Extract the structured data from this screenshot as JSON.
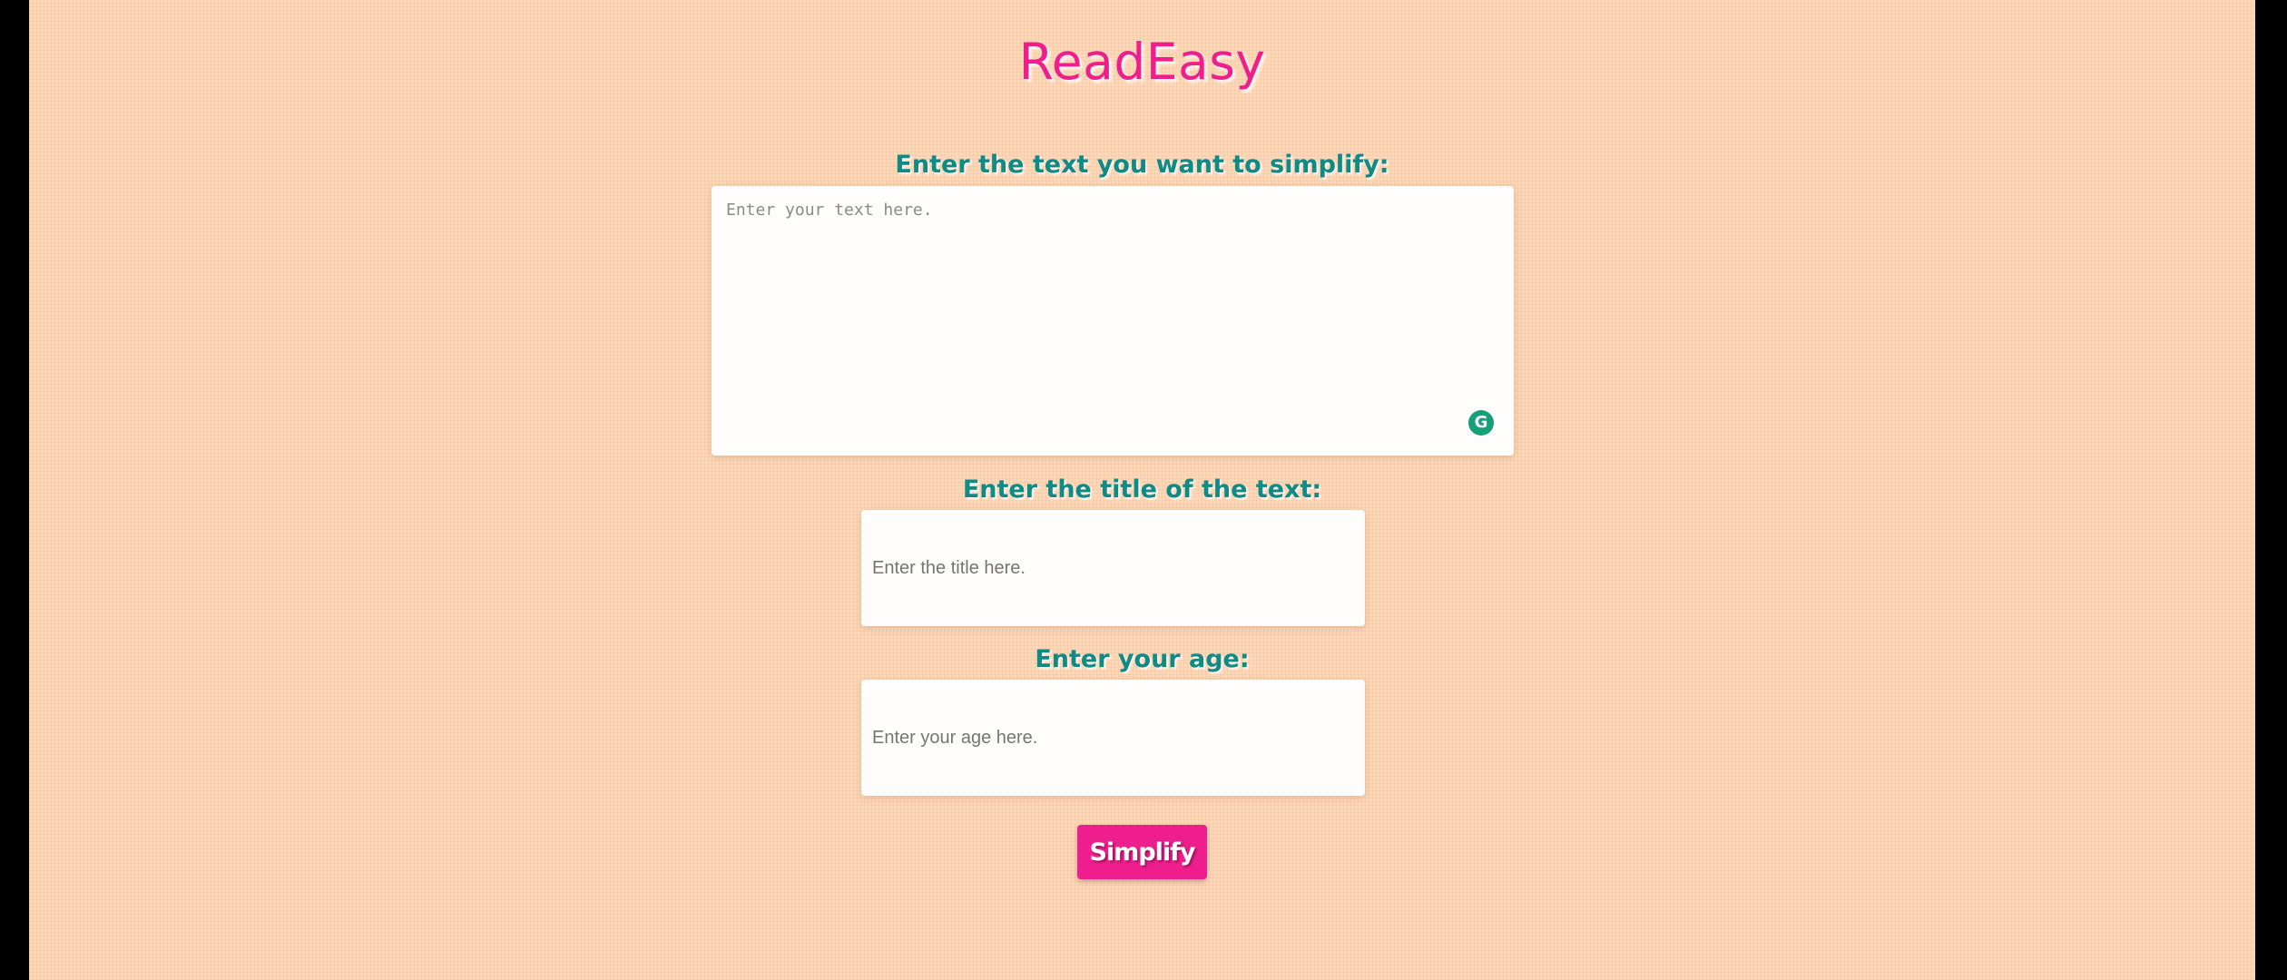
{
  "app": {
    "title": "ReadEasy"
  },
  "form": {
    "text_label": "Enter the text you want to simplify:",
    "text_placeholder": "Enter your text here.",
    "text_value": "",
    "title_label": "Enter the title of the text:",
    "title_placeholder": "Enter the title here.",
    "title_value": "",
    "age_label": "Enter your age:",
    "age_placeholder": "Enter your age here.",
    "age_value": "",
    "submit_label": "Simplify",
    "grammar_badge_letter": "G"
  },
  "colors": {
    "background": "#fcd8b8",
    "accent_pink": "#ee1f8c",
    "label_teal": "#0f8a85",
    "badge_green": "#15a079"
  },
  "icons": {
    "grammar_badge": "grammar-assistant-icon"
  }
}
